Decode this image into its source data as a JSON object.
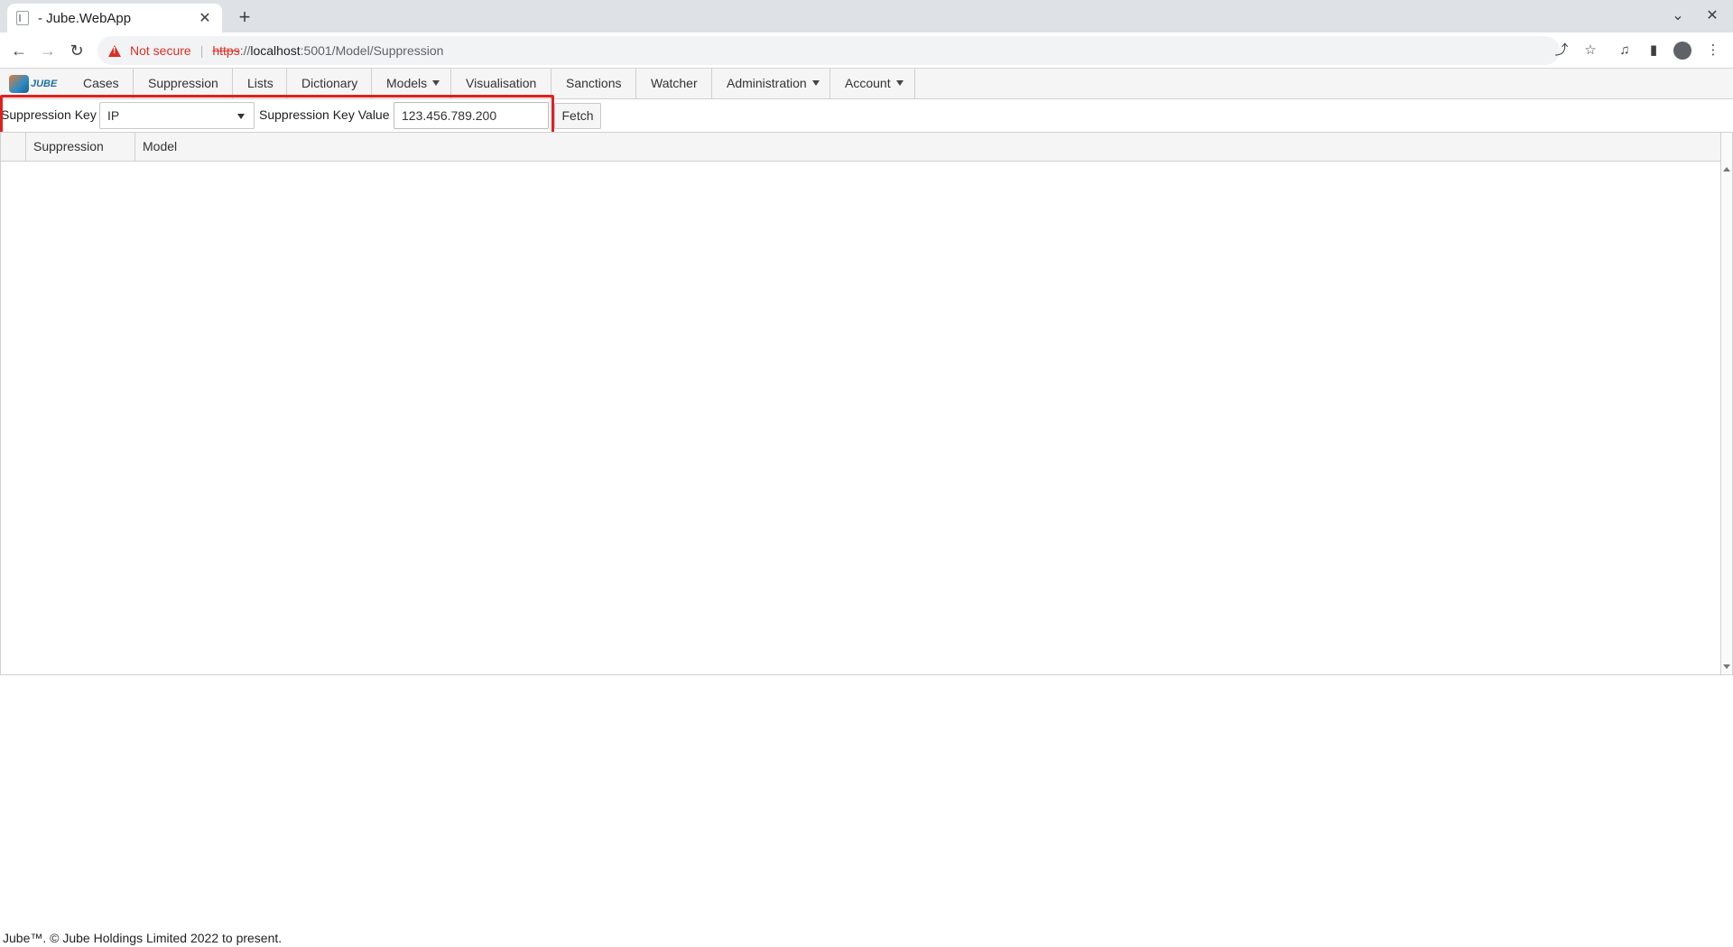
{
  "browser": {
    "tab_title": "- Jube.WebApp",
    "tab_close": "✕",
    "new_tab": "+",
    "security_label": "Not secure",
    "url_scheme": "https",
    "url_sep": "://",
    "url_host": "localhost",
    "url_path": ":5001/Model/Suppression"
  },
  "app": {
    "logo_text": "JUBE",
    "menu": [
      {
        "label": "Cases"
      },
      {
        "label": "Suppression"
      },
      {
        "label": "Lists"
      },
      {
        "label": "Dictionary"
      },
      {
        "label": "Models",
        "dropdown": true
      },
      {
        "label": "Visualisation"
      },
      {
        "label": "Sanctions"
      },
      {
        "label": "Watcher"
      },
      {
        "label": "Administration",
        "dropdown": true
      },
      {
        "label": "Account",
        "dropdown": true
      }
    ]
  },
  "filter": {
    "key_label": "Suppression Key",
    "key_value": "IP",
    "value_label": "Suppression Key Value",
    "value_input": "123.456.789.200",
    "fetch_label": "Fetch"
  },
  "grid": {
    "columns": [
      "Suppression",
      "Model"
    ]
  },
  "footer": {
    "text": "Jube™. © Jube Holdings Limited 2022 to present."
  },
  "colors": {
    "highlight": "#e02020",
    "warning": "#d93025"
  }
}
